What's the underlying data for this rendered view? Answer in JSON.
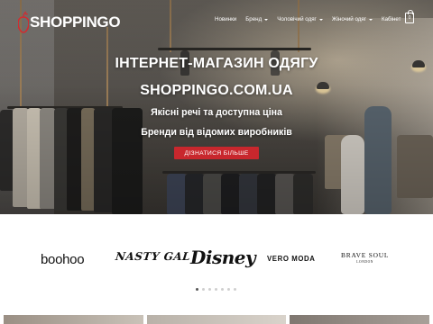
{
  "colors": {
    "accent": "#c8272d",
    "logo_red": "#d42a2f",
    "text_white": "#ffffff",
    "brand_text": "#111111"
  },
  "header": {
    "logo": {
      "text": "SHOPPINGO",
      "mark": "apple-icon"
    },
    "nav": [
      {
        "label": "Новинки",
        "dropdown": false
      },
      {
        "label": "Бренд",
        "dropdown": true
      },
      {
        "label": "Чоловічий одяг",
        "dropdown": true
      },
      {
        "label": "Жіночий одяг",
        "dropdown": true
      },
      {
        "label": "Кабінет",
        "dropdown": false
      }
    ],
    "cart": {
      "icon": "shopping-bag-icon",
      "count": "0"
    }
  },
  "hero": {
    "title_line1": "ІНТЕРНЕТ-МАГАЗИН ОДЯГУ",
    "title_line2": "SHOPPINGO.COM.UA",
    "subtitle_line1": "Якісні речі та доступна ціна",
    "subtitle_line2": "Бренди від відомих виробників",
    "cta_label": "ДІЗНАТИСЯ БІЛЬШЕ"
  },
  "brands": {
    "items": [
      {
        "name": "boohoo"
      },
      {
        "name": "NASTY GAL"
      },
      {
        "name": "Disney"
      },
      {
        "name": "VERO MODA"
      },
      {
        "name": "BRAVE SOUL",
        "sub": "LONDON"
      }
    ],
    "carousel": {
      "total_pages": 7,
      "active_index": 0
    }
  }
}
